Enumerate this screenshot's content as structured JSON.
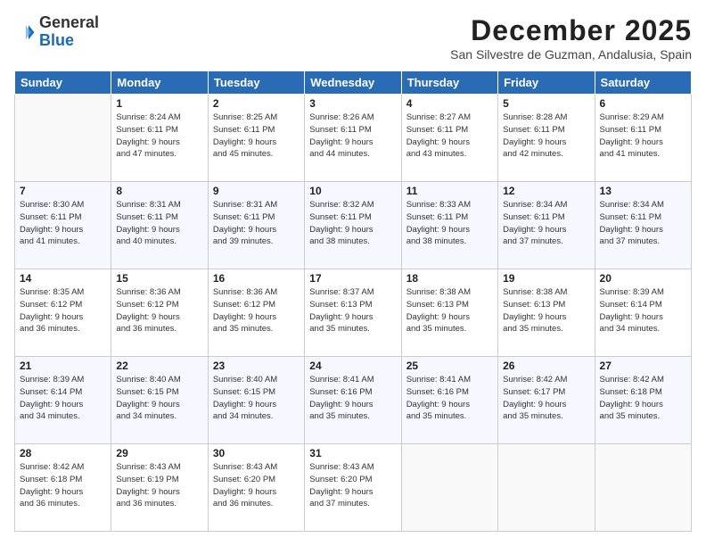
{
  "header": {
    "logo_general": "General",
    "logo_blue": "Blue",
    "month_title": "December 2025",
    "location": "San Silvestre de Guzman, Andalusia, Spain"
  },
  "columns": [
    "Sunday",
    "Monday",
    "Tuesday",
    "Wednesday",
    "Thursday",
    "Friday",
    "Saturday"
  ],
  "weeks": [
    [
      {
        "day": "",
        "info": ""
      },
      {
        "day": "1",
        "info": "Sunrise: 8:24 AM\nSunset: 6:11 PM\nDaylight: 9 hours\nand 47 minutes."
      },
      {
        "day": "2",
        "info": "Sunrise: 8:25 AM\nSunset: 6:11 PM\nDaylight: 9 hours\nand 45 minutes."
      },
      {
        "day": "3",
        "info": "Sunrise: 8:26 AM\nSunset: 6:11 PM\nDaylight: 9 hours\nand 44 minutes."
      },
      {
        "day": "4",
        "info": "Sunrise: 8:27 AM\nSunset: 6:11 PM\nDaylight: 9 hours\nand 43 minutes."
      },
      {
        "day": "5",
        "info": "Sunrise: 8:28 AM\nSunset: 6:11 PM\nDaylight: 9 hours\nand 42 minutes."
      },
      {
        "day": "6",
        "info": "Sunrise: 8:29 AM\nSunset: 6:11 PM\nDaylight: 9 hours\nand 41 minutes."
      }
    ],
    [
      {
        "day": "7",
        "info": "Sunrise: 8:30 AM\nSunset: 6:11 PM\nDaylight: 9 hours\nand 41 minutes."
      },
      {
        "day": "8",
        "info": "Sunrise: 8:31 AM\nSunset: 6:11 PM\nDaylight: 9 hours\nand 40 minutes."
      },
      {
        "day": "9",
        "info": "Sunrise: 8:31 AM\nSunset: 6:11 PM\nDaylight: 9 hours\nand 39 minutes."
      },
      {
        "day": "10",
        "info": "Sunrise: 8:32 AM\nSunset: 6:11 PM\nDaylight: 9 hours\nand 38 minutes."
      },
      {
        "day": "11",
        "info": "Sunrise: 8:33 AM\nSunset: 6:11 PM\nDaylight: 9 hours\nand 38 minutes."
      },
      {
        "day": "12",
        "info": "Sunrise: 8:34 AM\nSunset: 6:11 PM\nDaylight: 9 hours\nand 37 minutes."
      },
      {
        "day": "13",
        "info": "Sunrise: 8:34 AM\nSunset: 6:11 PM\nDaylight: 9 hours\nand 37 minutes."
      }
    ],
    [
      {
        "day": "14",
        "info": "Sunrise: 8:35 AM\nSunset: 6:12 PM\nDaylight: 9 hours\nand 36 minutes."
      },
      {
        "day": "15",
        "info": "Sunrise: 8:36 AM\nSunset: 6:12 PM\nDaylight: 9 hours\nand 36 minutes."
      },
      {
        "day": "16",
        "info": "Sunrise: 8:36 AM\nSunset: 6:12 PM\nDaylight: 9 hours\nand 35 minutes."
      },
      {
        "day": "17",
        "info": "Sunrise: 8:37 AM\nSunset: 6:13 PM\nDaylight: 9 hours\nand 35 minutes."
      },
      {
        "day": "18",
        "info": "Sunrise: 8:38 AM\nSunset: 6:13 PM\nDaylight: 9 hours\nand 35 minutes."
      },
      {
        "day": "19",
        "info": "Sunrise: 8:38 AM\nSunset: 6:13 PM\nDaylight: 9 hours\nand 35 minutes."
      },
      {
        "day": "20",
        "info": "Sunrise: 8:39 AM\nSunset: 6:14 PM\nDaylight: 9 hours\nand 34 minutes."
      }
    ],
    [
      {
        "day": "21",
        "info": "Sunrise: 8:39 AM\nSunset: 6:14 PM\nDaylight: 9 hours\nand 34 minutes."
      },
      {
        "day": "22",
        "info": "Sunrise: 8:40 AM\nSunset: 6:15 PM\nDaylight: 9 hours\nand 34 minutes."
      },
      {
        "day": "23",
        "info": "Sunrise: 8:40 AM\nSunset: 6:15 PM\nDaylight: 9 hours\nand 34 minutes."
      },
      {
        "day": "24",
        "info": "Sunrise: 8:41 AM\nSunset: 6:16 PM\nDaylight: 9 hours\nand 35 minutes."
      },
      {
        "day": "25",
        "info": "Sunrise: 8:41 AM\nSunset: 6:16 PM\nDaylight: 9 hours\nand 35 minutes."
      },
      {
        "day": "26",
        "info": "Sunrise: 8:42 AM\nSunset: 6:17 PM\nDaylight: 9 hours\nand 35 minutes."
      },
      {
        "day": "27",
        "info": "Sunrise: 8:42 AM\nSunset: 6:18 PM\nDaylight: 9 hours\nand 35 minutes."
      }
    ],
    [
      {
        "day": "28",
        "info": "Sunrise: 8:42 AM\nSunset: 6:18 PM\nDaylight: 9 hours\nand 36 minutes."
      },
      {
        "day": "29",
        "info": "Sunrise: 8:43 AM\nSunset: 6:19 PM\nDaylight: 9 hours\nand 36 minutes."
      },
      {
        "day": "30",
        "info": "Sunrise: 8:43 AM\nSunset: 6:20 PM\nDaylight: 9 hours\nand 36 minutes."
      },
      {
        "day": "31",
        "info": "Sunrise: 8:43 AM\nSunset: 6:20 PM\nDaylight: 9 hours\nand 37 minutes."
      },
      {
        "day": "",
        "info": ""
      },
      {
        "day": "",
        "info": ""
      },
      {
        "day": "",
        "info": ""
      }
    ]
  ]
}
